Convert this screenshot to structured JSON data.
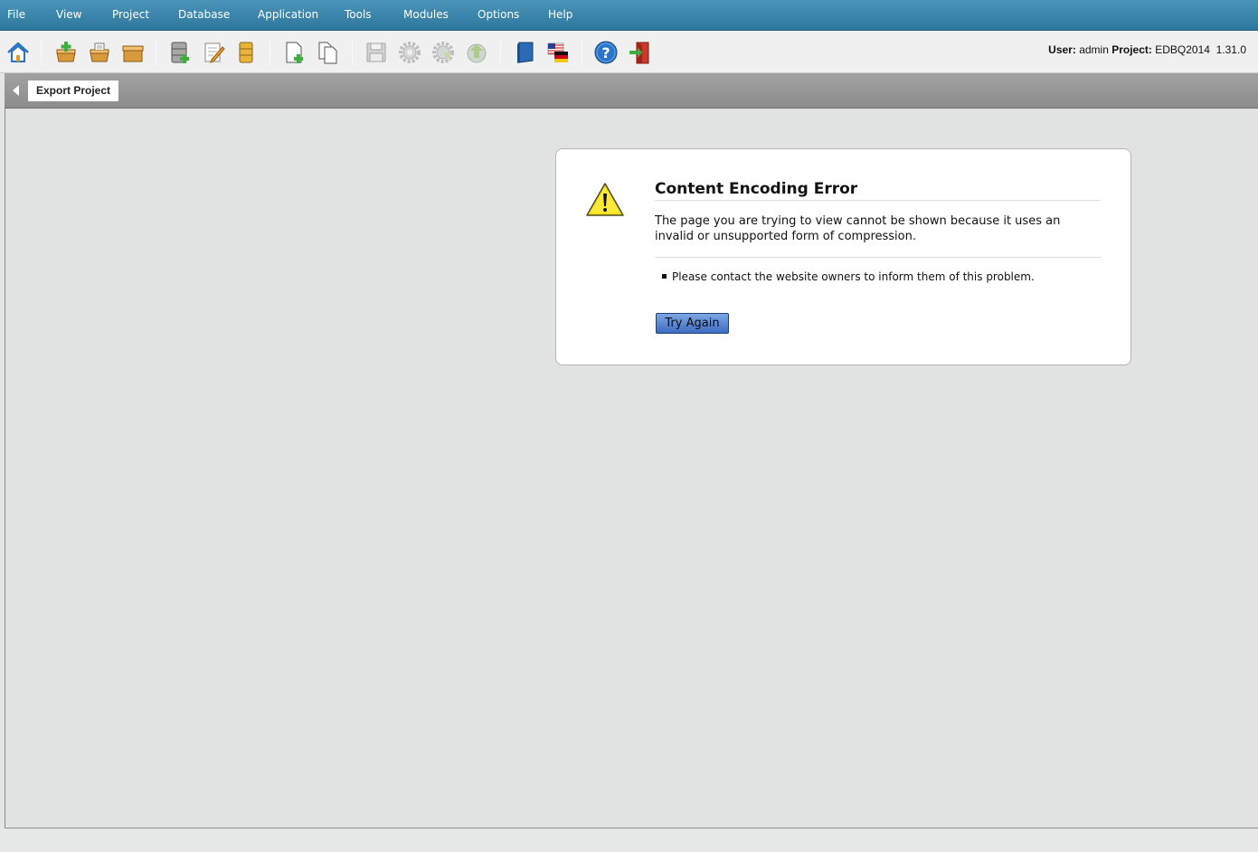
{
  "menubar": {
    "items": [
      {
        "label": "File"
      },
      {
        "label": "View"
      },
      {
        "label": "Project"
      },
      {
        "label": "Database"
      },
      {
        "label": "Application"
      },
      {
        "label": "Tools"
      },
      {
        "label": "Modules"
      },
      {
        "label": "Options"
      },
      {
        "label": "Help"
      }
    ]
  },
  "toolbar": {
    "icons": [
      "home-icon",
      "add-package-icon",
      "open-package-icon",
      "package-icon",
      "add-database-icon",
      "edit-database-icon",
      "database-icon",
      "new-document-icon",
      "copy-document-icon",
      "save-icon",
      "gear-icon",
      "gear-run-icon",
      "deploy-icon",
      "book-icon",
      "language-flags-icon",
      "help-icon",
      "exit-icon"
    ],
    "user_label": "User:",
    "user_value": "admin",
    "project_label": "Project:",
    "project_value": "EDBQ2014",
    "version": "1.31.0"
  },
  "tabs": {
    "active": "Export Project"
  },
  "error": {
    "title": "Content Encoding Error",
    "description": "The page you are trying to view cannot be shown because it uses an invalid or unsupported form of compression.",
    "bullet": "Please contact the website owners to inform them of this problem.",
    "button_label": "Try Again"
  },
  "colors": {
    "menubar": "#2e789e",
    "button": "#4a7ccd"
  }
}
